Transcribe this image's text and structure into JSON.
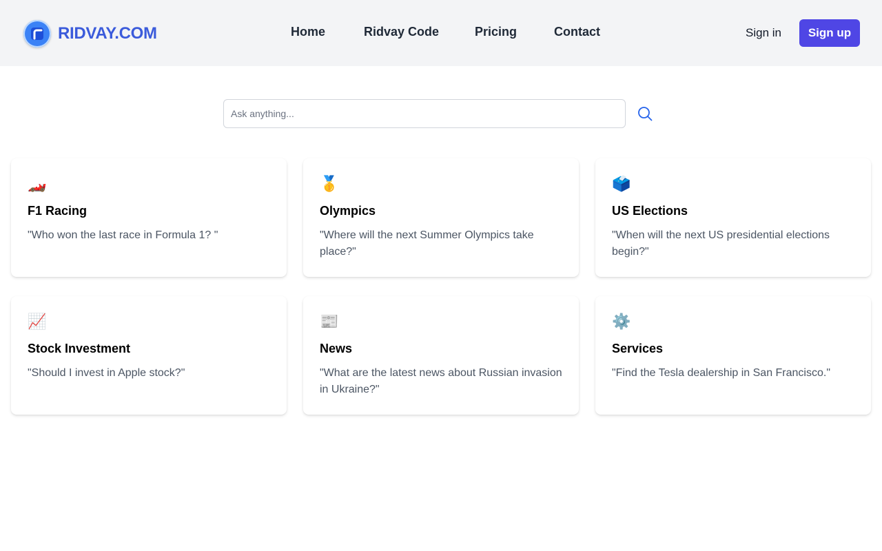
{
  "brand": {
    "name": "RIDVAY.COM",
    "icon": "logo-icon"
  },
  "nav": {
    "items": [
      {
        "label": "Home"
      },
      {
        "label": "Ridvay Code"
      },
      {
        "label": "Pricing"
      },
      {
        "label": "Contact"
      }
    ]
  },
  "auth": {
    "signin_label": "Sign in",
    "signup_label": "Sign up"
  },
  "search": {
    "placeholder": "Ask anything...",
    "value": "",
    "icon": "search-icon"
  },
  "colors": {
    "accent": "#4f46e5",
    "brand": "#3b5bdb",
    "search_icon": "#2563eb"
  },
  "cards": [
    {
      "emoji": "🏎️",
      "icon": "race-car-icon",
      "title": "F1 Racing",
      "query": "\"Who won the last race in Formula 1? \""
    },
    {
      "emoji": "🥇",
      "icon": "medal-icon",
      "title": "Olympics",
      "query": "\"Where will the next Summer Olympics take place?\""
    },
    {
      "emoji": "🗳️",
      "icon": "ballot-box-icon",
      "title": "US Elections",
      "query": "\"When will the next US presidential elections begin?\""
    },
    {
      "emoji": "📈",
      "icon": "chart-increasing-icon",
      "title": "Stock Investment",
      "query": "\"Should I invest in Apple stock?\""
    },
    {
      "emoji": "📰",
      "icon": "newspaper-icon",
      "title": "News",
      "query": "\"What are the latest news about Russian invasion in Ukraine?\""
    },
    {
      "emoji": "⚙️",
      "icon": "gear-icon",
      "title": "Services",
      "query": "\"Find the Tesla dealership in San Francisco.\""
    }
  ]
}
